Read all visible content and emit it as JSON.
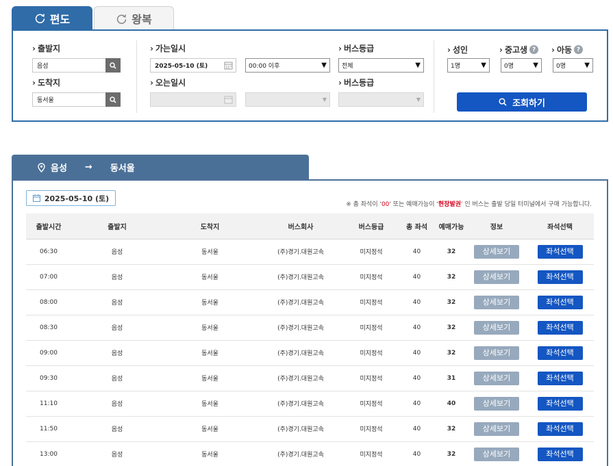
{
  "tabs": {
    "oneway": "편도",
    "roundtrip": "왕복"
  },
  "search": {
    "origin_label": "출발지",
    "origin_value": "음성",
    "dest_label": "도착지",
    "dest_value": "동서울",
    "depart_date_label": "가는일시",
    "depart_date_value": "2025-05-10 (토)",
    "depart_time_value": "00:00 이후",
    "return_date_label": "오는일시",
    "bus_grade_label": "버스등급",
    "bus_grade_value": "전체",
    "bus_grade_label2": "버스등급",
    "adult_label": "성인",
    "adult_value": "1명",
    "student_label": "중고생",
    "student_value": "0명",
    "child_label": "아동",
    "child_value": "0명",
    "help_symbol": "?",
    "lookup_button": "조회하기"
  },
  "route": {
    "origin": "음성",
    "dest": "동서울",
    "arrow": "→"
  },
  "results": {
    "date": "2025-05-10 (토)",
    "notice_prefix": "※ 총 좌석이 '",
    "notice_zero": "00",
    "notice_mid": "' 또는 예매가능이 '",
    "notice_onsite": "현장발권",
    "notice_suffix": "' 인 버스는 출발 당일 터미널에서 구매 가능합니다.",
    "columns": [
      "출발시간",
      "출발지",
      "도착지",
      "버스회사",
      "버스등급",
      "총 좌석",
      "예매가능",
      "정보",
      "좌석선택"
    ],
    "detail_label": "상세보기",
    "seat_label": "좌석선택",
    "rows": [
      {
        "time": "06:30",
        "origin": "음성",
        "dest": "동서울",
        "company": "(주)경기.대원고속",
        "grade": "미지정석",
        "total": "40",
        "avail": "32"
      },
      {
        "time": "07:00",
        "origin": "음성",
        "dest": "동서울",
        "company": "(주)경기.대원고속",
        "grade": "미지정석",
        "total": "40",
        "avail": "32"
      },
      {
        "time": "08:00",
        "origin": "음성",
        "dest": "동서울",
        "company": "(주)경기.대원고속",
        "grade": "미지정석",
        "total": "40",
        "avail": "32"
      },
      {
        "time": "08:30",
        "origin": "음성",
        "dest": "동서울",
        "company": "(주)경기.대원고속",
        "grade": "미지정석",
        "total": "40",
        "avail": "32"
      },
      {
        "time": "09:00",
        "origin": "음성",
        "dest": "동서울",
        "company": "(주)경기.대원고속",
        "grade": "미지정석",
        "total": "40",
        "avail": "32"
      },
      {
        "time": "09:30",
        "origin": "음성",
        "dest": "동서울",
        "company": "(주)경기.대원고속",
        "grade": "미지정석",
        "total": "40",
        "avail": "31"
      },
      {
        "time": "11:10",
        "origin": "음성",
        "dest": "동서울",
        "company": "(주)경기.대원고속",
        "grade": "미지정석",
        "total": "40",
        "avail": "40"
      },
      {
        "time": "11:50",
        "origin": "음성",
        "dest": "동서울",
        "company": "(주)경기.대원고속",
        "grade": "미지정석",
        "total": "40",
        "avail": "32"
      },
      {
        "time": "13:00",
        "origin": "음성",
        "dest": "동서울",
        "company": "(주)경기.대원고속",
        "grade": "미지정석",
        "total": "40",
        "avail": "32"
      }
    ]
  }
}
